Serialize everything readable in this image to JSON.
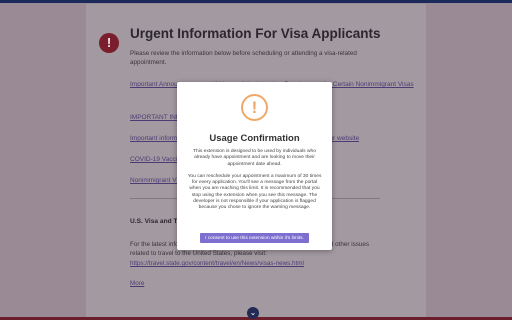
{
  "page": {
    "title": "Urgent Information For Visa Applicants",
    "intro": "Please review the information below before scheduling or attending a visa-related appointment.",
    "links": [
      "Important Announcement on Waivers of the Interview Requirement for Certain Nonimmigrant Visas",
      "IMPORTANT INFORMATION",
      "Important information on temporary visa processing adjustments on our website",
      "COVID-19 Vaccination Requirement",
      "Nonimmigrant Visa Interview Waiver"
    ],
    "section_heading": "U.S. Visa and Travel Information",
    "section_text": "For the latest information on U.S. entry requirements, including visas and other issues related to travel to the United States, please visit:",
    "state_link": "https://travel.state.gov/content/travel/en/News/visas-news.html",
    "more_label": "More",
    "scroll_icon": "chevron-down-icon"
  },
  "modal": {
    "icon": "!",
    "title": "Usage Confirmation",
    "paragraph1": "This extension is designed to be used by individuals who already have appointment and are looking to move their appointment date ahead.",
    "paragraph2": "You can reschedule your appointment a maximum of 30 times for every application. You'll see a message from the portal when you are reaching this limit. It is recommended that you stop using the extension when you see this message. The developer is not responsible if your application is flagged because you chose to ignore the warning message.",
    "button_label": "I consent to use this extension within it's limits."
  },
  "colors": {
    "overlay": "#9a8a96",
    "accent": "#7d6fcf",
    "warning": "#f0a869",
    "alert": "#7a1d2c"
  }
}
